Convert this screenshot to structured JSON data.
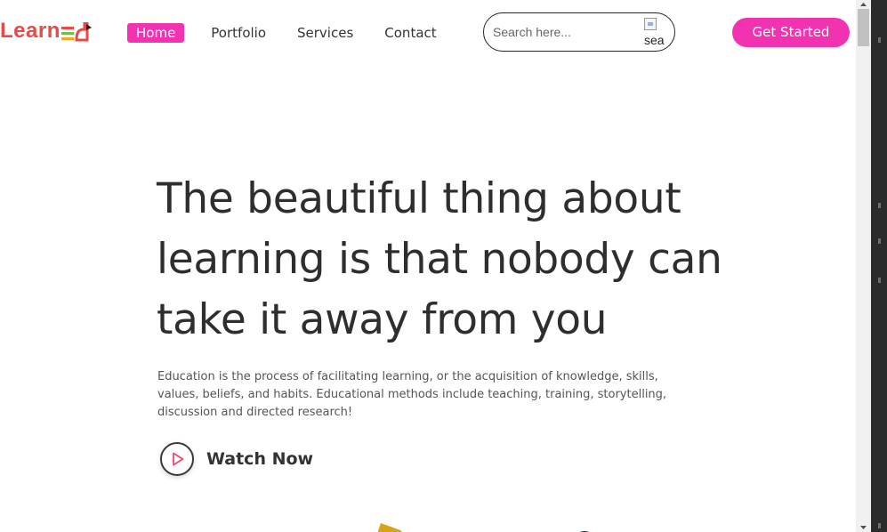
{
  "logo": {
    "text": "Learn",
    "mark_color": "#e84a4a"
  },
  "nav": {
    "items": [
      {
        "label": "Home",
        "active": true
      },
      {
        "label": "Portfolio",
        "active": false
      },
      {
        "label": "Services",
        "active": false
      },
      {
        "label": "Contact",
        "active": false
      }
    ]
  },
  "search": {
    "placeholder": "Search here...",
    "icon_alt": "sea"
  },
  "cta": {
    "label": "Get Started"
  },
  "hero": {
    "title": "The beautiful thing about learning is that nobody can take it away from you",
    "description": "Education is the process of facilitating learning, or the acquisition of knowledge, skills, values, beliefs, and habits. Educational methods include teaching, training, storytelling, discussion and directed research!",
    "watch_label": "Watch Now"
  },
  "colors": {
    "accent": "#f233b1",
    "logo": "#e84a4a",
    "text": "#2e2e2e",
    "play_icon": "#f04a6a"
  },
  "icons": {
    "search": "broken-image-icon",
    "play": "play-icon"
  }
}
